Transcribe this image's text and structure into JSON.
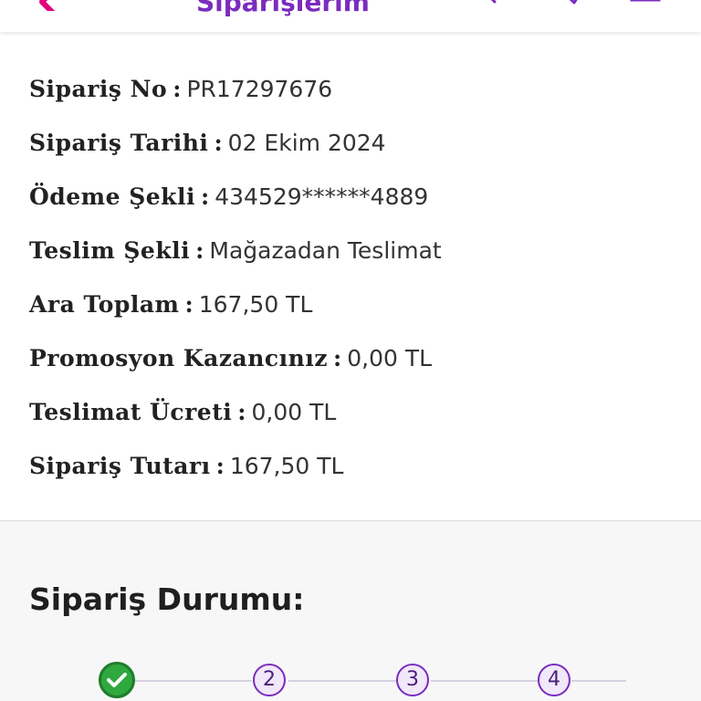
{
  "header": {
    "title": "Siparişlerim"
  },
  "order": {
    "rows": [
      {
        "label": "Sipariş No",
        "value": "PR17297676"
      },
      {
        "label": "Sipariş Tarihi",
        "value": "02 Ekim 2024"
      },
      {
        "label": "Ödeme Şekli",
        "value": "434529******4889"
      },
      {
        "label": "Teslim Şekli",
        "value": "Mağazadan Teslimat"
      },
      {
        "label": "Ara Toplam",
        "value": "167,50 TL"
      },
      {
        "label": "Promosyon Kazancınız",
        "value": "0,00 TL"
      },
      {
        "label": "Teslimat Ücreti",
        "value": "0,00 TL"
      },
      {
        "label": "Sipariş Tutarı",
        "value": "167,50 TL"
      }
    ],
    "separator": ":"
  },
  "status": {
    "title": "Sipariş Durumu:",
    "steps": [
      {
        "label": "",
        "state": "done"
      },
      {
        "label": "2",
        "state": "pending"
      },
      {
        "label": "3",
        "state": "pending"
      },
      {
        "label": "4",
        "state": "pending"
      }
    ]
  },
  "colors": {
    "accent": "#7b2cbf",
    "accent_light": "#f1e8fb",
    "success": "#2ea83f",
    "back_arrow": "#e2007a"
  },
  "icons": {
    "back": "back-arrow-icon",
    "search": "search-icon",
    "list": "order-list-icon",
    "cart": "cart-icon",
    "check": "check-icon"
  }
}
